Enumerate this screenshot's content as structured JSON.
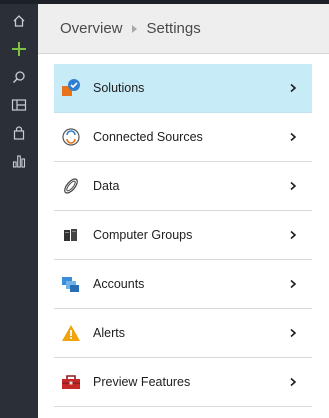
{
  "nav_rail": {
    "icons": [
      "home-icon",
      "plus-icon",
      "search-icon",
      "panel-icon",
      "shopping-bag-icon",
      "bar-chart-icon"
    ],
    "colors": {
      "background": "#2b2f38",
      "accent": "#7cc142",
      "icon": "#c9ccd3"
    }
  },
  "breadcrumb": {
    "items": [
      "Overview",
      "Settings"
    ]
  },
  "menu": {
    "items": [
      {
        "label": "Solutions",
        "icon": "solutions-icon",
        "selected": true
      },
      {
        "label": "Connected Sources",
        "icon": "connected-sources-icon",
        "selected": false
      },
      {
        "label": "Data",
        "icon": "data-icon",
        "selected": false
      },
      {
        "label": "Computer Groups",
        "icon": "computer-groups-icon",
        "selected": false
      },
      {
        "label": "Accounts",
        "icon": "accounts-icon",
        "selected": false
      },
      {
        "label": "Alerts",
        "icon": "alert-icon",
        "selected": false
      },
      {
        "label": "Preview Features",
        "icon": "toolbox-icon",
        "selected": false
      }
    ],
    "colors": {
      "selected_background": "#c7ecf8",
      "divider": "#d9d9d9"
    }
  }
}
